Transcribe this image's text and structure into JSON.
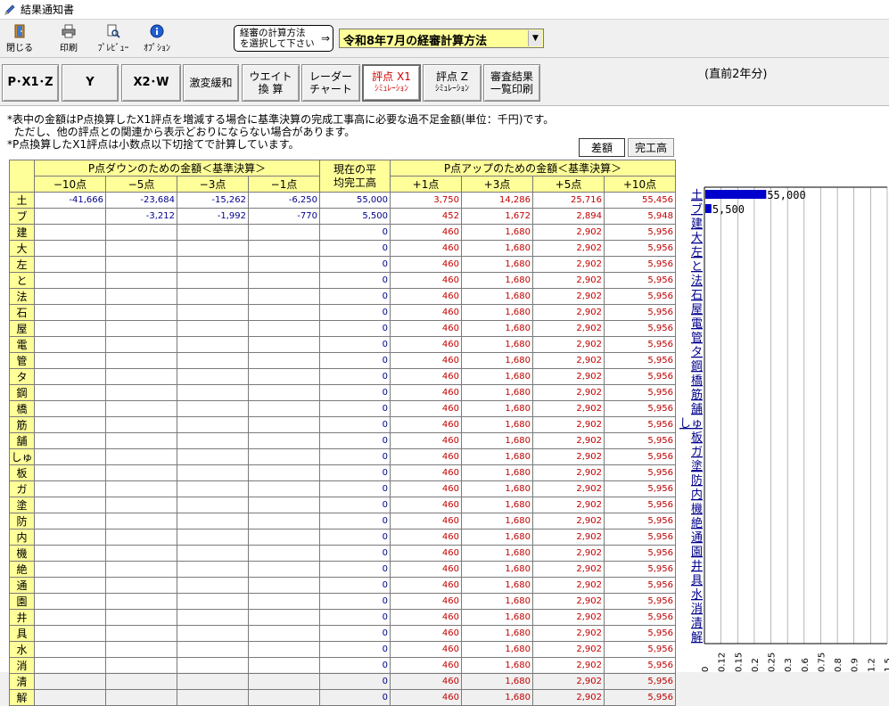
{
  "window": {
    "title": "結果通知書"
  },
  "toolbar": {
    "close": "閉じる",
    "print": "印刷",
    "preview": "ﾌﾟﾚﾋﾞｭｰ",
    "option": "ｵﾌﾟｼｮﾝ",
    "method_label_1": "経審の計算方法",
    "method_label_2": "を選択して下さい",
    "method_arrow": "⇒",
    "method_value": "令和8年7月の経審計算方法"
  },
  "nav": {
    "pxz": "P･X1･Z",
    "y": "Y",
    "x2w": "X2･W",
    "gekihen": "激変緩和",
    "weight_1": "ウエイト",
    "weight_2": "換 算",
    "radar_1": "レーダー",
    "radar_2": "チャート",
    "x1sim_1": "評点 X1",
    "x1sim_2": "ｼﾐｭﾚｰｼｮﾝ",
    "zsim_1": "評点 Z",
    "zsim_2": "ｼﾐｭﾚｰｼｮﾝ",
    "result_1": "審査結果",
    "result_2": "一覧印刷"
  },
  "notes": {
    "line1": "*表中の金額はP点換算したX1評点を増減する場合に基準決算の完成工事高に必要な過不足金額(単位：千円)です。",
    "line2": "  ただし、他の評点との関連から表示どおりにならない場合があります。",
    "line3": "*P点換算したX1評点は小数点以下切捨てで計算しています。"
  },
  "switch": {
    "diff": "差額",
    "sales": "完工高"
  },
  "table": {
    "header_down": "P点ダウンのための金額＜基準決算＞",
    "header_current_1": "現在の平",
    "header_current_2": "均完工高",
    "header_up": "P点アップのための金額＜基準決算＞",
    "cols": [
      "−10点",
      "−5点",
      "−3点",
      "−1点",
      "+1点",
      "+3点",
      "+5点",
      "+10点"
    ],
    "rows": [
      {
        "label": "土",
        "m10": "-41,666",
        "m5": "-23,684",
        "m3": "-15,262",
        "m1": "-6,250",
        "cur": "55,000",
        "p1": "3,750",
        "p3": "14,286",
        "p5": "25,716",
        "p10": "55,456"
      },
      {
        "label": "ブ",
        "m10": "",
        "m5": "-3,212",
        "m3": "-1,992",
        "m1": "-770",
        "cur": "5,500",
        "p1": "452",
        "p3": "1,672",
        "p5": "2,894",
        "p10": "5,948"
      },
      {
        "label": "建",
        "m10": "",
        "m5": "",
        "m3": "",
        "m1": "",
        "cur": "0",
        "p1": "460",
        "p3": "1,680",
        "p5": "2,902",
        "p10": "5,956"
      },
      {
        "label": "大",
        "m10": "",
        "m5": "",
        "m3": "",
        "m1": "",
        "cur": "0",
        "p1": "460",
        "p3": "1,680",
        "p5": "2,902",
        "p10": "5,956"
      },
      {
        "label": "左",
        "m10": "",
        "m5": "",
        "m3": "",
        "m1": "",
        "cur": "0",
        "p1": "460",
        "p3": "1,680",
        "p5": "2,902",
        "p10": "5,956"
      },
      {
        "label": "と",
        "m10": "",
        "m5": "",
        "m3": "",
        "m1": "",
        "cur": "0",
        "p1": "460",
        "p3": "1,680",
        "p5": "2,902",
        "p10": "5,956"
      },
      {
        "label": "法",
        "m10": "",
        "m5": "",
        "m3": "",
        "m1": "",
        "cur": "0",
        "p1": "460",
        "p3": "1,680",
        "p5": "2,902",
        "p10": "5,956"
      },
      {
        "label": "石",
        "m10": "",
        "m5": "",
        "m3": "",
        "m1": "",
        "cur": "0",
        "p1": "460",
        "p3": "1,680",
        "p5": "2,902",
        "p10": "5,956"
      },
      {
        "label": "屋",
        "m10": "",
        "m5": "",
        "m3": "",
        "m1": "",
        "cur": "0",
        "p1": "460",
        "p3": "1,680",
        "p5": "2,902",
        "p10": "5,956"
      },
      {
        "label": "電",
        "m10": "",
        "m5": "",
        "m3": "",
        "m1": "",
        "cur": "0",
        "p1": "460",
        "p3": "1,680",
        "p5": "2,902",
        "p10": "5,956"
      },
      {
        "label": "管",
        "m10": "",
        "m5": "",
        "m3": "",
        "m1": "",
        "cur": "0",
        "p1": "460",
        "p3": "1,680",
        "p5": "2,902",
        "p10": "5,956"
      },
      {
        "label": "タ",
        "m10": "",
        "m5": "",
        "m3": "",
        "m1": "",
        "cur": "0",
        "p1": "460",
        "p3": "1,680",
        "p5": "2,902",
        "p10": "5,956"
      },
      {
        "label": "鋼",
        "m10": "",
        "m5": "",
        "m3": "",
        "m1": "",
        "cur": "0",
        "p1": "460",
        "p3": "1,680",
        "p5": "2,902",
        "p10": "5,956"
      },
      {
        "label": "橋",
        "m10": "",
        "m5": "",
        "m3": "",
        "m1": "",
        "cur": "0",
        "p1": "460",
        "p3": "1,680",
        "p5": "2,902",
        "p10": "5,956"
      },
      {
        "label": "筋",
        "m10": "",
        "m5": "",
        "m3": "",
        "m1": "",
        "cur": "0",
        "p1": "460",
        "p3": "1,680",
        "p5": "2,902",
        "p10": "5,956"
      },
      {
        "label": "舗",
        "m10": "",
        "m5": "",
        "m3": "",
        "m1": "",
        "cur": "0",
        "p1": "460",
        "p3": "1,680",
        "p5": "2,902",
        "p10": "5,956"
      },
      {
        "label": "しゅ",
        "m10": "",
        "m5": "",
        "m3": "",
        "m1": "",
        "cur": "0",
        "p1": "460",
        "p3": "1,680",
        "p5": "2,902",
        "p10": "5,956"
      },
      {
        "label": "板",
        "m10": "",
        "m5": "",
        "m3": "",
        "m1": "",
        "cur": "0",
        "p1": "460",
        "p3": "1,680",
        "p5": "2,902",
        "p10": "5,956"
      },
      {
        "label": "ガ",
        "m10": "",
        "m5": "",
        "m3": "",
        "m1": "",
        "cur": "0",
        "p1": "460",
        "p3": "1,680",
        "p5": "2,902",
        "p10": "5,956"
      },
      {
        "label": "塗",
        "m10": "",
        "m5": "",
        "m3": "",
        "m1": "",
        "cur": "0",
        "p1": "460",
        "p3": "1,680",
        "p5": "2,902",
        "p10": "5,956"
      },
      {
        "label": "防",
        "m10": "",
        "m5": "",
        "m3": "",
        "m1": "",
        "cur": "0",
        "p1": "460",
        "p3": "1,680",
        "p5": "2,902",
        "p10": "5,956"
      },
      {
        "label": "内",
        "m10": "",
        "m5": "",
        "m3": "",
        "m1": "",
        "cur": "0",
        "p1": "460",
        "p3": "1,680",
        "p5": "2,902",
        "p10": "5,956"
      },
      {
        "label": "機",
        "m10": "",
        "m5": "",
        "m3": "",
        "m1": "",
        "cur": "0",
        "p1": "460",
        "p3": "1,680",
        "p5": "2,902",
        "p10": "5,956"
      },
      {
        "label": "絶",
        "m10": "",
        "m5": "",
        "m3": "",
        "m1": "",
        "cur": "0",
        "p1": "460",
        "p3": "1,680",
        "p5": "2,902",
        "p10": "5,956"
      },
      {
        "label": "通",
        "m10": "",
        "m5": "",
        "m3": "",
        "m1": "",
        "cur": "0",
        "p1": "460",
        "p3": "1,680",
        "p5": "2,902",
        "p10": "5,956"
      },
      {
        "label": "園",
        "m10": "",
        "m5": "",
        "m3": "",
        "m1": "",
        "cur": "0",
        "p1": "460",
        "p3": "1,680",
        "p5": "2,902",
        "p10": "5,956"
      },
      {
        "label": "井",
        "m10": "",
        "m5": "",
        "m3": "",
        "m1": "",
        "cur": "0",
        "p1": "460",
        "p3": "1,680",
        "p5": "2,902",
        "p10": "5,956"
      },
      {
        "label": "具",
        "m10": "",
        "m5": "",
        "m3": "",
        "m1": "",
        "cur": "0",
        "p1": "460",
        "p3": "1,680",
        "p5": "2,902",
        "p10": "5,956"
      },
      {
        "label": "水",
        "m10": "",
        "m5": "",
        "m3": "",
        "m1": "",
        "cur": "0",
        "p1": "460",
        "p3": "1,680",
        "p5": "2,902",
        "p10": "5,956"
      },
      {
        "label": "消",
        "m10": "",
        "m5": "",
        "m3": "",
        "m1": "",
        "cur": "0",
        "p1": "460",
        "p3": "1,680",
        "p5": "2,902",
        "p10": "5,956"
      },
      {
        "label": "清",
        "m10": "",
        "m5": "",
        "m3": "",
        "m1": "",
        "cur": "0",
        "p1": "460",
        "p3": "1,680",
        "p5": "2,902",
        "p10": "5,956"
      },
      {
        "label": "解",
        "m10": "",
        "m5": "",
        "m3": "",
        "m1": "",
        "cur": "0",
        "p1": "460",
        "p3": "1,680",
        "p5": "2,902",
        "p10": "5,956"
      }
    ]
  },
  "colors": {
    "header_bg": "#ffff99",
    "negative_text": "#00008b",
    "positive_text": "#c00000",
    "bar": "#0000cc",
    "category_text": "#00008b"
  },
  "chart_data": {
    "type": "bar",
    "orientation": "horizontal",
    "title": "(直前2年分)",
    "categories": [
      "土",
      "ブ",
      "建",
      "大",
      "左",
      "と",
      "法",
      "石",
      "屋",
      "電",
      "管",
      "タ",
      "鋼",
      "橋",
      "筋",
      "舗",
      "しゅ",
      "板",
      "ガ",
      "塗",
      "防",
      "内",
      "機",
      "絶",
      "通",
      "園",
      "井",
      "具",
      "水",
      "消",
      "清",
      "解"
    ],
    "values": [
      55000,
      5500,
      0,
      0,
      0,
      0,
      0,
      0,
      0,
      0,
      0,
      0,
      0,
      0,
      0,
      0,
      0,
      0,
      0,
      0,
      0,
      0,
      0,
      0,
      0,
      0,
      0,
      0,
      0,
      0,
      0,
      0
    ],
    "value_labels": [
      "55,000",
      "5,500"
    ],
    "x_ticks": [
      "0",
      "0.12",
      "0.15",
      "0.2",
      "0.25",
      "0.3",
      "0.6",
      "0.75",
      "0.8",
      "0.9",
      "1.2",
      "1.5"
    ],
    "grid": true
  }
}
